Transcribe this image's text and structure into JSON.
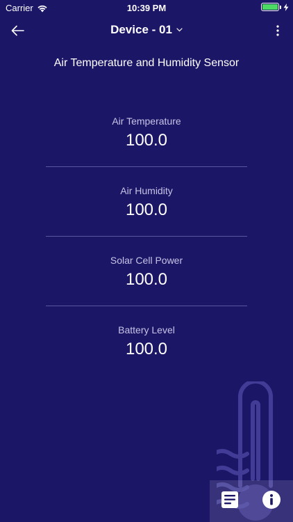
{
  "status_bar": {
    "carrier": "Carrier",
    "time": "10:39 PM",
    "battery_level": 1.0,
    "battery_color": "#4cd964"
  },
  "nav": {
    "title": "Device - 01",
    "back_icon": "arrow-left-icon",
    "dropdown_icon": "chevron-down-icon",
    "more_icon": "vertical-dots-icon"
  },
  "sensor": {
    "title": "Air Temperature and Humidity Sensor"
  },
  "readings": [
    {
      "label": "Air Temperature",
      "value": "100.0"
    },
    {
      "label": "Air Humidity",
      "value": "100.0"
    },
    {
      "label": "Solar Cell Power",
      "value": "100.0"
    },
    {
      "label": "Battery Level",
      "value": "100.0"
    }
  ],
  "actions": {
    "doc_icon": "document-icon",
    "info_icon": "info-icon"
  },
  "colors": {
    "background": "#1c1667",
    "divider": "#5b56a0",
    "label": "#c6c4e6",
    "text": "#ffffff"
  }
}
